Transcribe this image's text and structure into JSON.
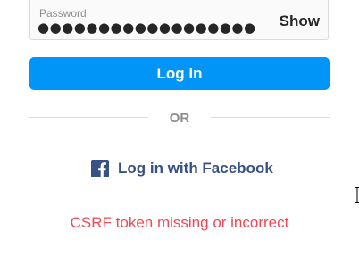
{
  "password_field": {
    "label": "Password",
    "masked_value": "●●●●●●●●●●●●●●●●●●",
    "toggle_label": "Show"
  },
  "login": {
    "button_label": "Log in"
  },
  "divider": {
    "text": "OR"
  },
  "facebook": {
    "icon": "facebook-icon",
    "label": "Log in with Facebook"
  },
  "error": {
    "message": "CSRF token missing or incorrect"
  },
  "colors": {
    "primary": "#0095f6",
    "facebook": "#385185",
    "error": "#ed4956",
    "muted": "#8e8e8e"
  }
}
